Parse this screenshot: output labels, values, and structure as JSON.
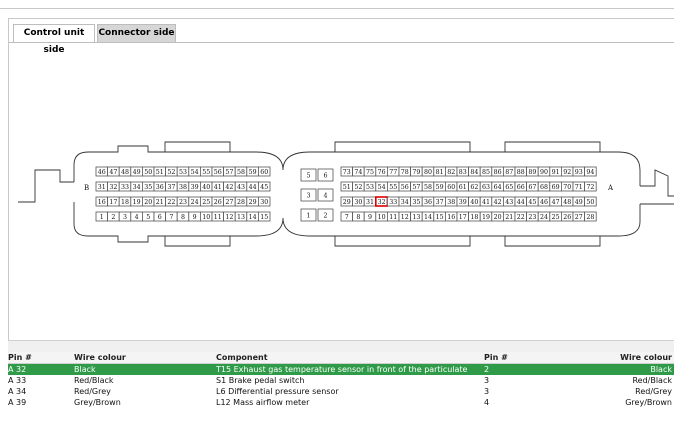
{
  "tabs": [
    {
      "label": "Control unit side",
      "active": true
    },
    {
      "label": "Connector side",
      "active": false
    }
  ],
  "connector": {
    "left_block": {
      "label": "B",
      "rows": [
        [
          "46",
          "47",
          "48",
          "49",
          "50",
          "51",
          "52",
          "53",
          "54",
          "55",
          "56",
          "57",
          "58",
          "59",
          "60"
        ],
        [
          "31",
          "32",
          "33",
          "34",
          "35",
          "36",
          "37",
          "38",
          "39",
          "40",
          "41",
          "42",
          "43",
          "44",
          "45"
        ],
        [
          "16",
          "17",
          "18",
          "19",
          "20",
          "21",
          "22",
          "23",
          "24",
          "25",
          "26",
          "27",
          "28",
          "29",
          "30"
        ],
        [
          "1",
          "2",
          "3",
          "4",
          "5",
          "6",
          "7",
          "8",
          "9",
          "10",
          "11",
          "12",
          "13",
          "14",
          "15"
        ]
      ]
    },
    "middle_block": {
      "pairs": [
        [
          "5",
          "6"
        ],
        [
          "3",
          "4"
        ],
        [
          "1",
          "2"
        ]
      ]
    },
    "right_block": {
      "label": "A",
      "selected_pin": "32",
      "rows": [
        [
          "73",
          "74",
          "75",
          "76",
          "77",
          "78",
          "79",
          "80",
          "81",
          "82",
          "83",
          "84",
          "85",
          "86",
          "87",
          "88",
          "89",
          "90",
          "91",
          "92",
          "93",
          "94"
        ],
        [
          "51",
          "52",
          "53",
          "54",
          "55",
          "56",
          "57",
          "58",
          "59",
          "60",
          "61",
          "62",
          "63",
          "64",
          "65",
          "66",
          "67",
          "68",
          "69",
          "70",
          "71",
          "72"
        ],
        [
          "29",
          "30",
          "31",
          "32",
          "33",
          "34",
          "35",
          "36",
          "37",
          "38",
          "39",
          "40",
          "41",
          "42",
          "43",
          "44",
          "45",
          "46",
          "47",
          "48",
          "49",
          "50"
        ],
        [
          "7",
          "8",
          "9",
          "10",
          "11",
          "12",
          "13",
          "14",
          "15",
          "16",
          "17",
          "18",
          "19",
          "20",
          "21",
          "22",
          "23",
          "24",
          "25",
          "26",
          "27",
          "28"
        ]
      ]
    }
  },
  "table": {
    "headers": {
      "pin": "Pin #",
      "wire_colour": "Wire colour",
      "component": "Component",
      "pin2": "Pin #",
      "wire_colour2": "Wire colour"
    },
    "rows": [
      {
        "pin": "A 32",
        "wire_colour": "Black",
        "component": "T15 Exhaust gas temperature sensor in front of the particulate",
        "pin2": "2",
        "wire_colour2": "Black",
        "selected": true
      },
      {
        "pin": "A 33",
        "wire_colour": "Red/Black",
        "component": "S1 Brake pedal switch",
        "pin2": "3",
        "wire_colour2": "Red/Black",
        "selected": false
      },
      {
        "pin": "A 34",
        "wire_colour": "Red/Grey",
        "component": "L6 Differential pressure sensor",
        "pin2": "3",
        "wire_colour2": "Red/Grey",
        "selected": false
      },
      {
        "pin": "A 39",
        "wire_colour": "Grey/Brown",
        "component": "L12 Mass airflow meter",
        "pin2": "4",
        "wire_colour2": "Grey/Brown",
        "selected": false
      }
    ]
  },
  "colors": {
    "selected_row": "#2f9a48",
    "selected_pin": "#e00000"
  }
}
